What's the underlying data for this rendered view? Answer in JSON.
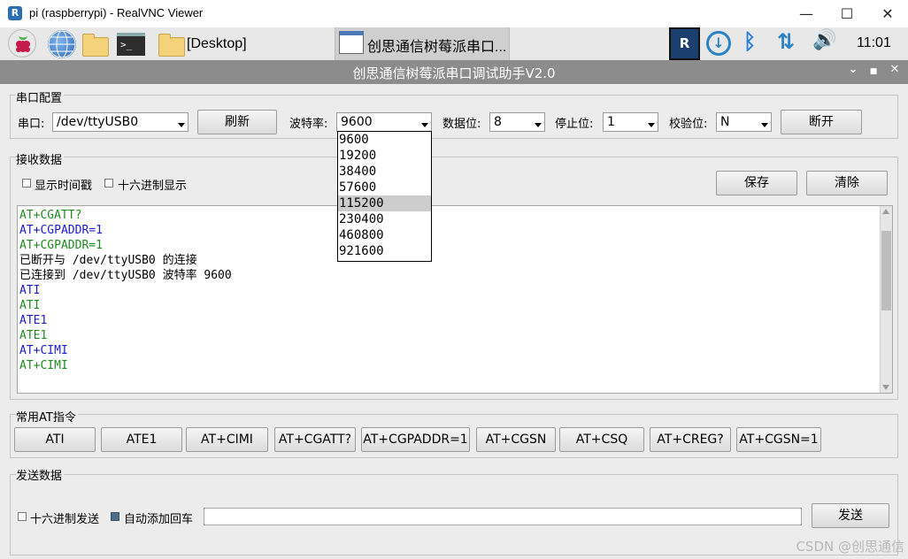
{
  "window": {
    "title": "pi (raspberrypi) - RealVNC Viewer",
    "logo": "R",
    "minimize": "—",
    "maximize": "☐",
    "close": "✕"
  },
  "taskbar": {
    "desktop_label": "[Desktop]",
    "app_task_label": "创思通信树莓派串口...",
    "clock": "11:01",
    "terminal_glyph": ">_",
    "vnc_glyph": "R",
    "download_glyph": "↓",
    "bluetooth_glyph": "ᛒ",
    "network_glyph": "⇅",
    "volume_glyph": "🔊"
  },
  "app": {
    "title": "创思通信树莓派串口调试助手V2.0",
    "btn_shade": "⌄",
    "btn_max": "■",
    "btn_close": "✕"
  },
  "serial_config": {
    "group_title": "串口配置",
    "port_label": "串口:",
    "port_value": "/dev/ttyUSB0",
    "refresh_button": "刷新",
    "baud_label": "波特率:",
    "baud_value": "9600",
    "databits_label": "数据位:",
    "databits_value": "8",
    "stopbits_label": "停止位:",
    "stopbits_value": "1",
    "parity_label": "校验位:",
    "parity_value": "N",
    "disconnect_button": "断开"
  },
  "baud_options": [
    "9600",
    "19200",
    "38400",
    "57600",
    "115200",
    "230400",
    "460800",
    "921600"
  ],
  "baud_highlighted_index": 4,
  "receive": {
    "group_title": "接收数据",
    "show_timestamp_label": "显示时间戳",
    "show_timestamp_checked": false,
    "hex_display_label": "十六进制显示",
    "hex_display_checked": false,
    "save_button": "保存",
    "clear_button": "清除",
    "lines": [
      {
        "text": "AT+CGATT?",
        "color": "#1f8a1f"
      },
      {
        "text": "AT+CGPADDR=1",
        "color": "#1c1ccf"
      },
      {
        "text": "AT+CGPADDR=1",
        "color": "#1f8a1f"
      },
      {
        "text": "已断开与 /dev/ttyUSB0 的连接",
        "color": "#000000"
      },
      {
        "text": "已连接到 /dev/ttyUSB0 波特率 9600",
        "color": "#000000"
      },
      {
        "text": "ATI",
        "color": "#1c1ccf"
      },
      {
        "text": "ATI",
        "color": "#1f8a1f"
      },
      {
        "text": "ATE1",
        "color": "#1c1ccf"
      },
      {
        "text": "ATE1",
        "color": "#1f8a1f"
      },
      {
        "text": "AT+CIMI",
        "color": "#1c1ccf"
      },
      {
        "text": "AT+CIMI",
        "color": "#1f8a1f"
      }
    ]
  },
  "at_commands": {
    "group_title": "常用AT指令",
    "buttons": [
      "ATI",
      "ATE1",
      "AT+CIMI",
      "AT+CGATT?",
      "AT+CGPADDR=1",
      "AT+CGSN",
      "AT+CSQ",
      "AT+CREG?",
      "AT+CGSN=1"
    ]
  },
  "send": {
    "group_title": "发送数据",
    "hex_send_label": "十六进制发送",
    "hex_send_checked": false,
    "auto_newline_label": "自动添加回车",
    "auto_newline_checked": true,
    "input_value": "",
    "send_button": "发送"
  },
  "watermark": "CSDN @创思通信"
}
